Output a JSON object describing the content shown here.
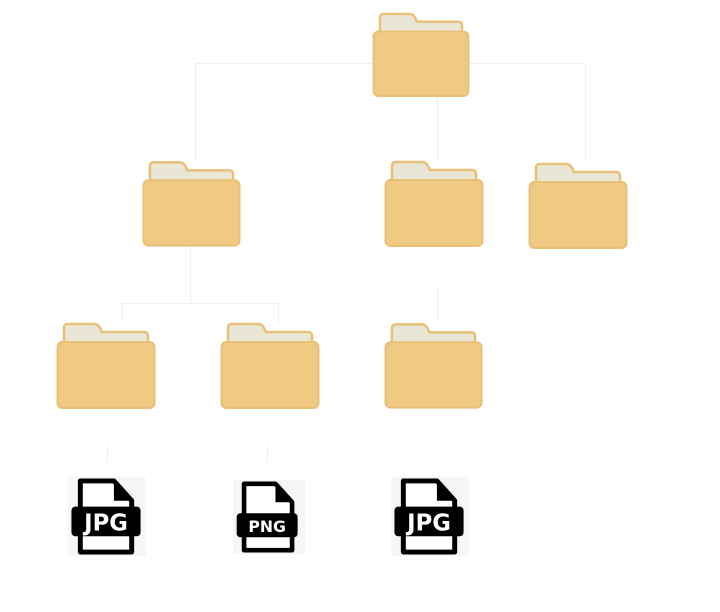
{
  "colors": {
    "folder_body": "#f0c983",
    "folder_border": "#e8c078",
    "folder_paper": "#e9e6d6",
    "connector": "#efefef",
    "file_icon": "#000000"
  },
  "tree": {
    "root": {
      "type": "folder",
      "icon": "folder-icon"
    },
    "level2": [
      {
        "type": "folder",
        "icon": "folder-icon"
      },
      {
        "type": "folder",
        "icon": "folder-icon"
      },
      {
        "type": "folder",
        "icon": "folder-icon"
      }
    ],
    "level3": [
      {
        "type": "folder",
        "icon": "folder-icon"
      },
      {
        "type": "folder",
        "icon": "folder-icon"
      },
      {
        "type": "folder",
        "icon": "folder-icon"
      }
    ],
    "files": [
      {
        "type": "file",
        "icon": "jpg-file-icon",
        "badge": "JPG"
      },
      {
        "type": "file",
        "icon": "png-file-icon",
        "badge": "PNG"
      },
      {
        "type": "file",
        "icon": "jpg-file-icon",
        "badge": "JPG"
      }
    ]
  }
}
